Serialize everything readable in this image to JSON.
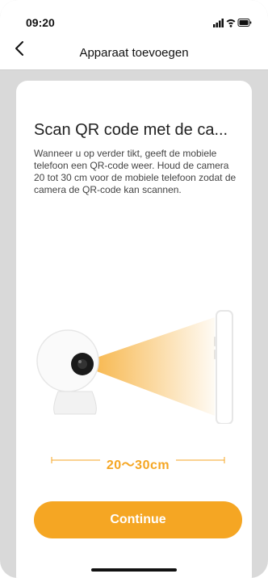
{
  "status_bar": {
    "time": "09:20",
    "icons": [
      "signal-icon",
      "wifi-icon",
      "battery-icon"
    ]
  },
  "nav": {
    "title": "Apparaat toevoegen",
    "back_icon": "chevron-left-icon"
  },
  "card": {
    "title": "Scan QR code met de ca...",
    "description": "Wanneer u op verder tikt, geeft de mobiele telefoon een QR-code weer. Houd de camera 20 tot 30 cm voor de mobiele telefoon zodat de camera de QR-code kan scannen.",
    "distance_label": "20～30cm",
    "continue_label": "Continue"
  },
  "colors": {
    "accent": "#f5a623",
    "background": "#d9d9d9",
    "card": "#ffffff"
  }
}
